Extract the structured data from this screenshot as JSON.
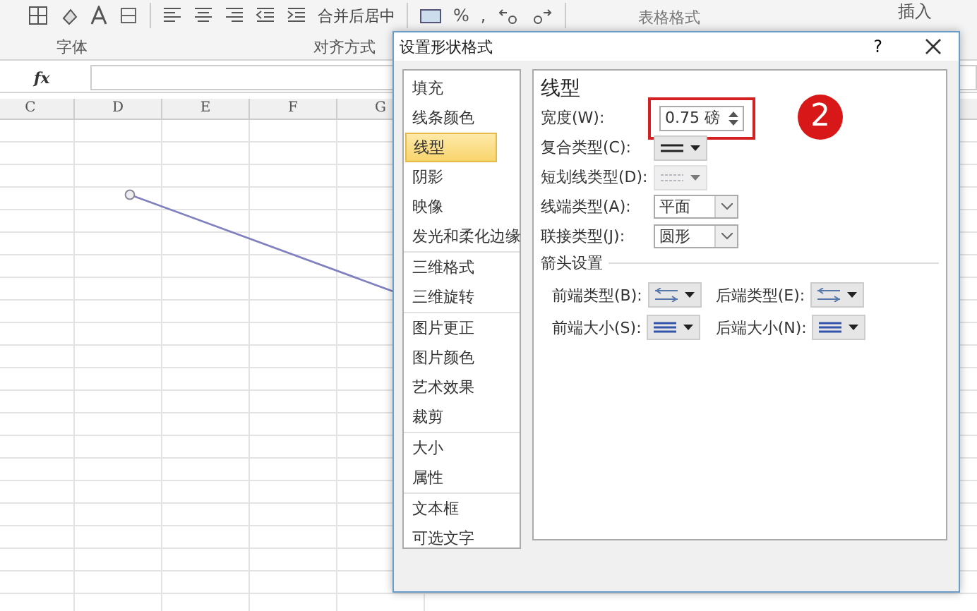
{
  "ribbon": {
    "merge_button": "合并后居中",
    "percent": "%",
    "comma": ",",
    "table_format": "表格格式",
    "insert": "插入",
    "groups": [
      {
        "label": "字体"
      },
      {
        "label": "对齐方式"
      }
    ]
  },
  "formula_bar": {
    "fx": "fx"
  },
  "sheet": {
    "columns": [
      "C",
      "D",
      "E",
      "F",
      "G"
    ]
  },
  "dialog": {
    "title": "设置形状格式",
    "help": "?",
    "categories": [
      [
        {
          "label": "填充",
          "selected": false
        },
        {
          "label": "线条颜色",
          "selected": false
        },
        {
          "label": "线型",
          "selected": true
        },
        {
          "label": "阴影",
          "selected": false
        },
        {
          "label": "映像",
          "selected": false
        },
        {
          "label": "发光和柔化边缘",
          "selected": false
        }
      ],
      [
        {
          "label": "三维格式",
          "selected": false
        },
        {
          "label": "三维旋转",
          "selected": false
        }
      ],
      [
        {
          "label": "图片更正",
          "selected": false
        },
        {
          "label": "图片颜色",
          "selected": false
        },
        {
          "label": "艺术效果",
          "selected": false
        },
        {
          "label": "裁剪",
          "selected": false
        }
      ],
      [
        {
          "label": "大小",
          "selected": false
        },
        {
          "label": "属性",
          "selected": false
        }
      ],
      [
        {
          "label": "文本框",
          "selected": false
        },
        {
          "label": "可选文字",
          "selected": false
        }
      ]
    ],
    "heading": "线型",
    "width": {
      "label": "宽度(W):",
      "value": "0.75 磅"
    },
    "step_badge": "2",
    "rows": [
      {
        "kind": "compound",
        "label": "复合类型(C):",
        "disabled": false
      },
      {
        "kind": "dash",
        "label": "短划线类型(D):",
        "disabled": true
      },
      {
        "kind": "select",
        "label": "线端类型(A):",
        "value": "平面"
      },
      {
        "kind": "select",
        "label": "联接类型(J):",
        "value": "圆形"
      }
    ],
    "arrow_section": "箭头设置",
    "arrows": [
      {
        "kind": "type",
        "label": "前端类型(B):"
      },
      {
        "kind": "type",
        "label": "后端类型(E):"
      },
      {
        "kind": "size",
        "label": "前端大小(S):"
      },
      {
        "kind": "size",
        "label": "后端大小(N):"
      }
    ]
  }
}
